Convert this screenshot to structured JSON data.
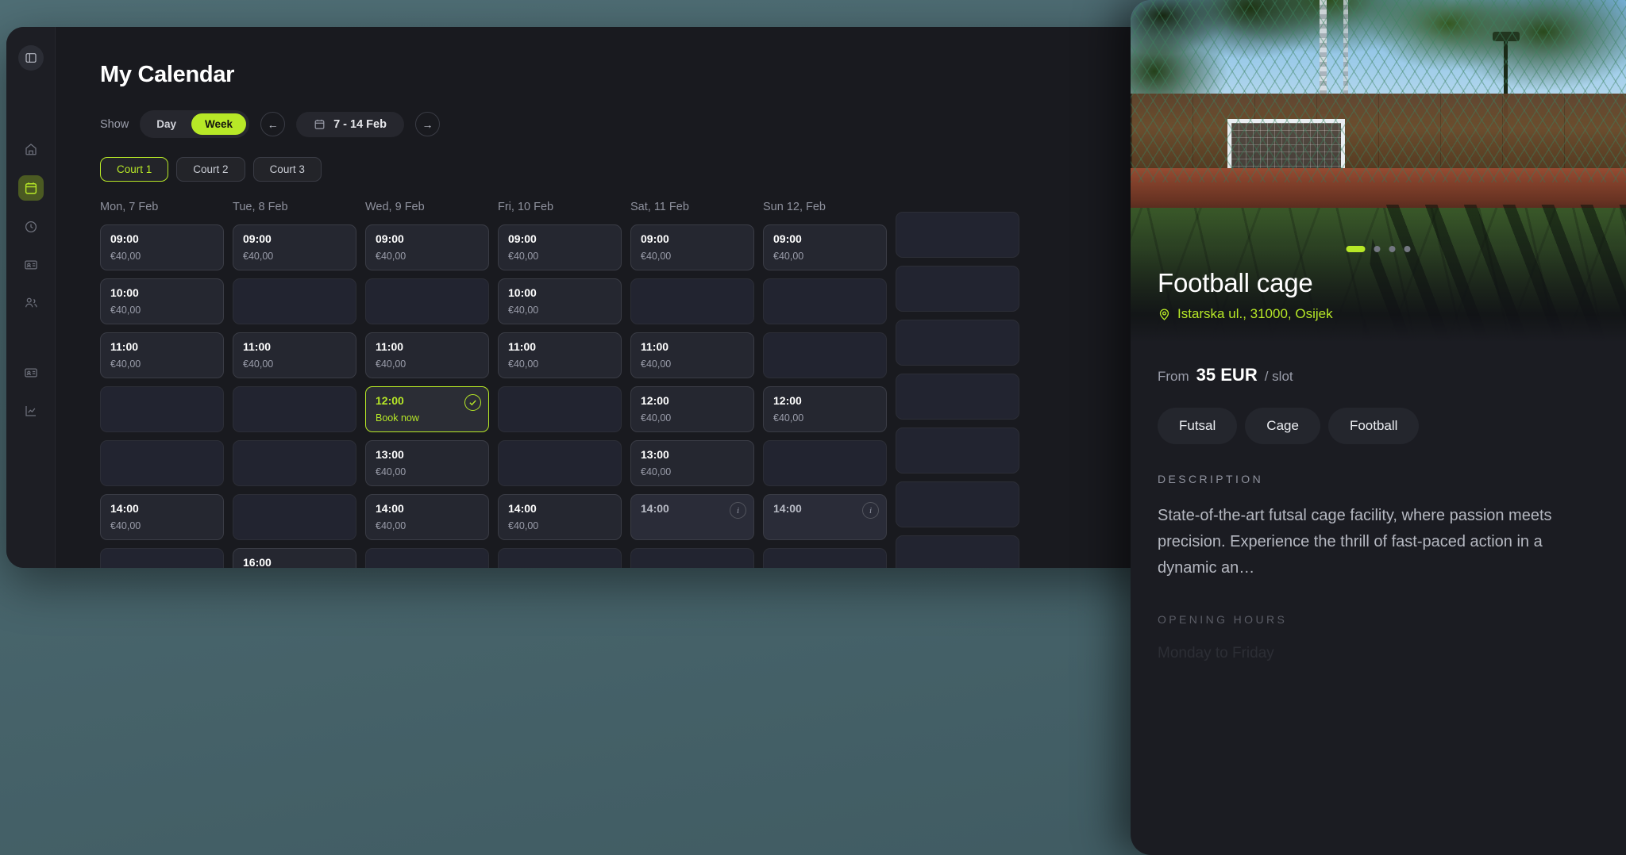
{
  "app": {
    "page_title": "My Calendar",
    "accent": "#b7e827"
  },
  "sidebar": {
    "panel_toggle": "panel-toggle-icon",
    "items": [
      {
        "name": "dashboard",
        "icon": "dashboard-icon",
        "active": false
      },
      {
        "name": "calendar",
        "icon": "calendar-icon",
        "active": true
      },
      {
        "name": "history",
        "icon": "clock-icon",
        "active": false
      },
      {
        "name": "membership-card",
        "icon": "id-card-icon",
        "active": false
      },
      {
        "name": "members",
        "icon": "users-icon",
        "active": false
      },
      {
        "name": "billing",
        "icon": "card-icon",
        "active": false
      },
      {
        "name": "analytics",
        "icon": "chart-icon",
        "active": false
      }
    ]
  },
  "controls": {
    "show_label": "Show",
    "view_options": [
      "Day",
      "Week"
    ],
    "view_selected": "Week",
    "prev_label": "←",
    "next_label": "→",
    "date_range": "7 - 14 Feb",
    "calendar_icon": "calendar-icon"
  },
  "courts": {
    "tabs": [
      "Court 1",
      "Court 2",
      "Court 3"
    ],
    "selected": "Court 1"
  },
  "calendar": {
    "days": [
      {
        "header": "Mon, 7 Feb"
      },
      {
        "header": "Tue, 8 Feb"
      },
      {
        "header": "Wed, 9 Feb"
      },
      {
        "header": "Fri, 10 Feb"
      },
      {
        "header": "Sat, 11 Feb"
      },
      {
        "header": "Sun 12, Feb"
      },
      {
        "header": ""
      }
    ],
    "price_default": "€40,00",
    "book_now_label": "Book now",
    "rows": [
      [
        {
          "time": "09:00",
          "price": "€40,00",
          "state": "available"
        },
        {
          "time": "09:00",
          "price": "€40,00",
          "state": "available"
        },
        {
          "time": "09:00",
          "price": "€40,00",
          "state": "available"
        },
        {
          "time": "09:00",
          "price": "€40,00",
          "state": "available"
        },
        {
          "time": "09:00",
          "price": "€40,00",
          "state": "available"
        },
        {
          "time": "09:00",
          "price": "€40,00",
          "state": "available"
        },
        {
          "time": "",
          "price": "",
          "state": "empty"
        }
      ],
      [
        {
          "time": "10:00",
          "price": "€40,00",
          "state": "available"
        },
        {
          "time": "",
          "price": "",
          "state": "empty"
        },
        {
          "time": "",
          "price": "",
          "state": "empty"
        },
        {
          "time": "10:00",
          "price": "€40,00",
          "state": "available"
        },
        {
          "time": "",
          "price": "",
          "state": "empty"
        },
        {
          "time": "",
          "price": "",
          "state": "empty"
        },
        {
          "time": "",
          "price": "",
          "state": "empty"
        }
      ],
      [
        {
          "time": "11:00",
          "price": "€40,00",
          "state": "available"
        },
        {
          "time": "11:00",
          "price": "€40,00",
          "state": "available"
        },
        {
          "time": "11:00",
          "price": "€40,00",
          "state": "available"
        },
        {
          "time": "11:00",
          "price": "€40,00",
          "state": "available"
        },
        {
          "time": "11:00",
          "price": "€40,00",
          "state": "available"
        },
        {
          "time": "",
          "price": "",
          "state": "empty"
        },
        {
          "time": "",
          "price": "",
          "state": "empty"
        }
      ],
      [
        {
          "time": "",
          "price": "",
          "state": "empty"
        },
        {
          "time": "",
          "price": "",
          "state": "empty"
        },
        {
          "time": "12:00",
          "price": "Book now",
          "state": "selected"
        },
        {
          "time": "",
          "price": "",
          "state": "empty"
        },
        {
          "time": "12:00",
          "price": "€40,00",
          "state": "available"
        },
        {
          "time": "12:00",
          "price": "€40,00",
          "state": "available"
        },
        {
          "time": "",
          "price": "",
          "state": "empty"
        }
      ],
      [
        {
          "time": "",
          "price": "",
          "state": "empty"
        },
        {
          "time": "",
          "price": "",
          "state": "empty"
        },
        {
          "time": "13:00",
          "price": "€40,00",
          "state": "available"
        },
        {
          "time": "",
          "price": "",
          "state": "empty"
        },
        {
          "time": "13:00",
          "price": "€40,00",
          "state": "available"
        },
        {
          "time": "",
          "price": "",
          "state": "empty"
        },
        {
          "time": "",
          "price": "",
          "state": "empty"
        }
      ],
      [
        {
          "time": "14:00",
          "price": "€40,00",
          "state": "available"
        },
        {
          "time": "",
          "price": "",
          "state": "empty"
        },
        {
          "time": "14:00",
          "price": "€40,00",
          "state": "available"
        },
        {
          "time": "14:00",
          "price": "€40,00",
          "state": "available"
        },
        {
          "time": "14:00",
          "price": "",
          "state": "info"
        },
        {
          "time": "14:00",
          "price": "",
          "state": "info"
        },
        {
          "time": "",
          "price": "",
          "state": "empty"
        }
      ],
      [
        {
          "time": "",
          "price": "",
          "state": "empty"
        },
        {
          "time": "16:00",
          "price": "",
          "state": "available"
        },
        {
          "time": "",
          "price": "",
          "state": "empty"
        },
        {
          "time": "",
          "price": "",
          "state": "empty"
        },
        {
          "time": "",
          "price": "",
          "state": "empty"
        },
        {
          "time": "",
          "price": "",
          "state": "empty"
        },
        {
          "time": "",
          "price": "",
          "state": "empty"
        }
      ]
    ]
  },
  "detail": {
    "venue_name": "Football cage",
    "address": "Istarska ul., 31000, Osijek",
    "location_icon": "map-pin-icon",
    "carousel": {
      "count": 4,
      "active_index": 0
    },
    "price_from_label": "From",
    "price_value": "35 EUR",
    "price_unit": "/ slot",
    "tags": [
      "Futsal",
      "Cage",
      "Football"
    ],
    "description_label": "DESCRIPTION",
    "description": "State-of-the-art futsal cage facility, where passion meets precision. Experience the thrill of fast-paced action in a dynamic an…",
    "opening_hours_label": "OPENING HOURS",
    "opening_hours_first": "Monday to Friday"
  }
}
